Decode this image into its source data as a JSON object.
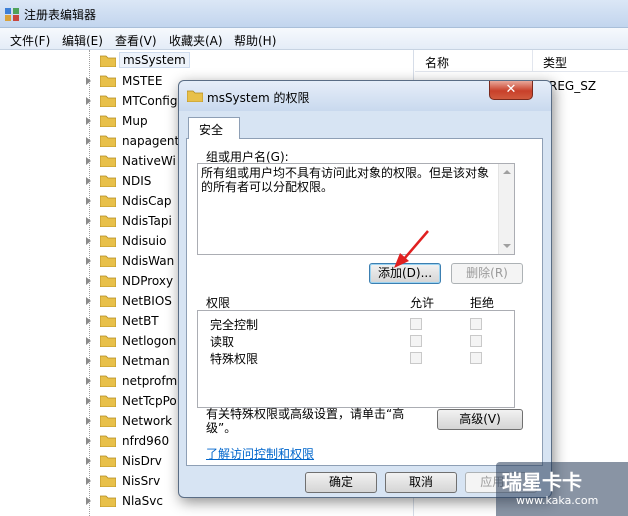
{
  "window": {
    "title": "注册表编辑器"
  },
  "menu": [
    "文件(F)",
    "编辑(E)",
    "查看(V)",
    "收藏夹(A)",
    "帮助(H)"
  ],
  "tree": {
    "items": [
      "msSystem",
      "MSTEE",
      "MTConfig",
      "Mup",
      "napagent",
      "NativeWi",
      "NDIS",
      "NdisCap",
      "NdisTapi",
      "Ndisuio",
      "NdisWan",
      "NDProxy",
      "NetBIOS",
      "NetBT",
      "Netlogon",
      "Netman",
      "netprofm",
      "NetTcpPo",
      "Network",
      "nfrd960",
      "NisDrv",
      "NisSrv",
      "NlaSvc"
    ],
    "selected": "msSystem"
  },
  "values_pane": {
    "col_name": "名称",
    "col_type": "类型",
    "row_type": "REG_SZ"
  },
  "dialog": {
    "title": "msSystem 的权限",
    "close_glyph": "✕",
    "tab_security": "安全",
    "group_label": "组或用户名(G):",
    "group_message": "所有组或用户均不具有访问此对象的权限。但是该对象的所有者可以分配权限。",
    "add_button": "添加(D)...",
    "remove_button": "删除(R)",
    "perm_label": "权限",
    "allow_label": "允许",
    "deny_label": "拒绝",
    "permissions": [
      "完全控制",
      "读取",
      "特殊权限"
    ],
    "advanced_hint": "有关特殊权限或高级设置，请单击“高级”。",
    "advanced_button": "高级(V)",
    "learn_link": "了解访问控制和权限",
    "ok_button": "确定",
    "cancel_button": "取消",
    "apply_button": "应用(A)"
  },
  "watermark": {
    "line1": "瑞星卡卡",
    "line2": "www.kaka.com"
  }
}
